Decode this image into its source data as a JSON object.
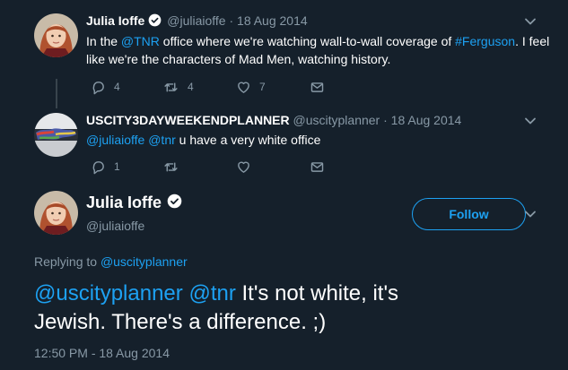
{
  "tweets": [
    {
      "name": "Julia Ioffe",
      "handle": "@juliaioffe",
      "sep": "·",
      "date": "18 Aug 2014",
      "text_a": "In the ",
      "mention_a": "@TNR",
      "text_b": " office where we're watching wall-to-wall coverage of ",
      "hashtag": "#Ferguson",
      "text_c": ". I feel like we're the characters of Mad Men, watching history.",
      "reply_count": "4",
      "retweet_count": "4",
      "like_count": "7"
    },
    {
      "name": "USCITY3DAYWEEKENDPLANNER",
      "handle": "@uscityplanner",
      "sep": "·",
      "date": "18 Aug 2014",
      "mention_a": "@juliaioffe",
      "mention_b": "@tnr",
      "text": " u have a very white office",
      "reply_count": "1"
    }
  ],
  "main_tweet": {
    "name": "Julia Ioffe",
    "handle": "@juliaioffe",
    "follow_label": "Follow",
    "replying_prefix": "Replying to ",
    "replying_to": "@uscityplanner",
    "mention_a": "@uscityplanner",
    "mention_b": "@tnr",
    "text": " It's not white, it's Jewish. There's a difference. ;)",
    "timestamp": "12:50 PM - 18 Aug 2014"
  },
  "colors": {
    "background": "#15202b",
    "accent": "#1da1f2",
    "muted": "#8899a6",
    "divider": "#38444d"
  }
}
